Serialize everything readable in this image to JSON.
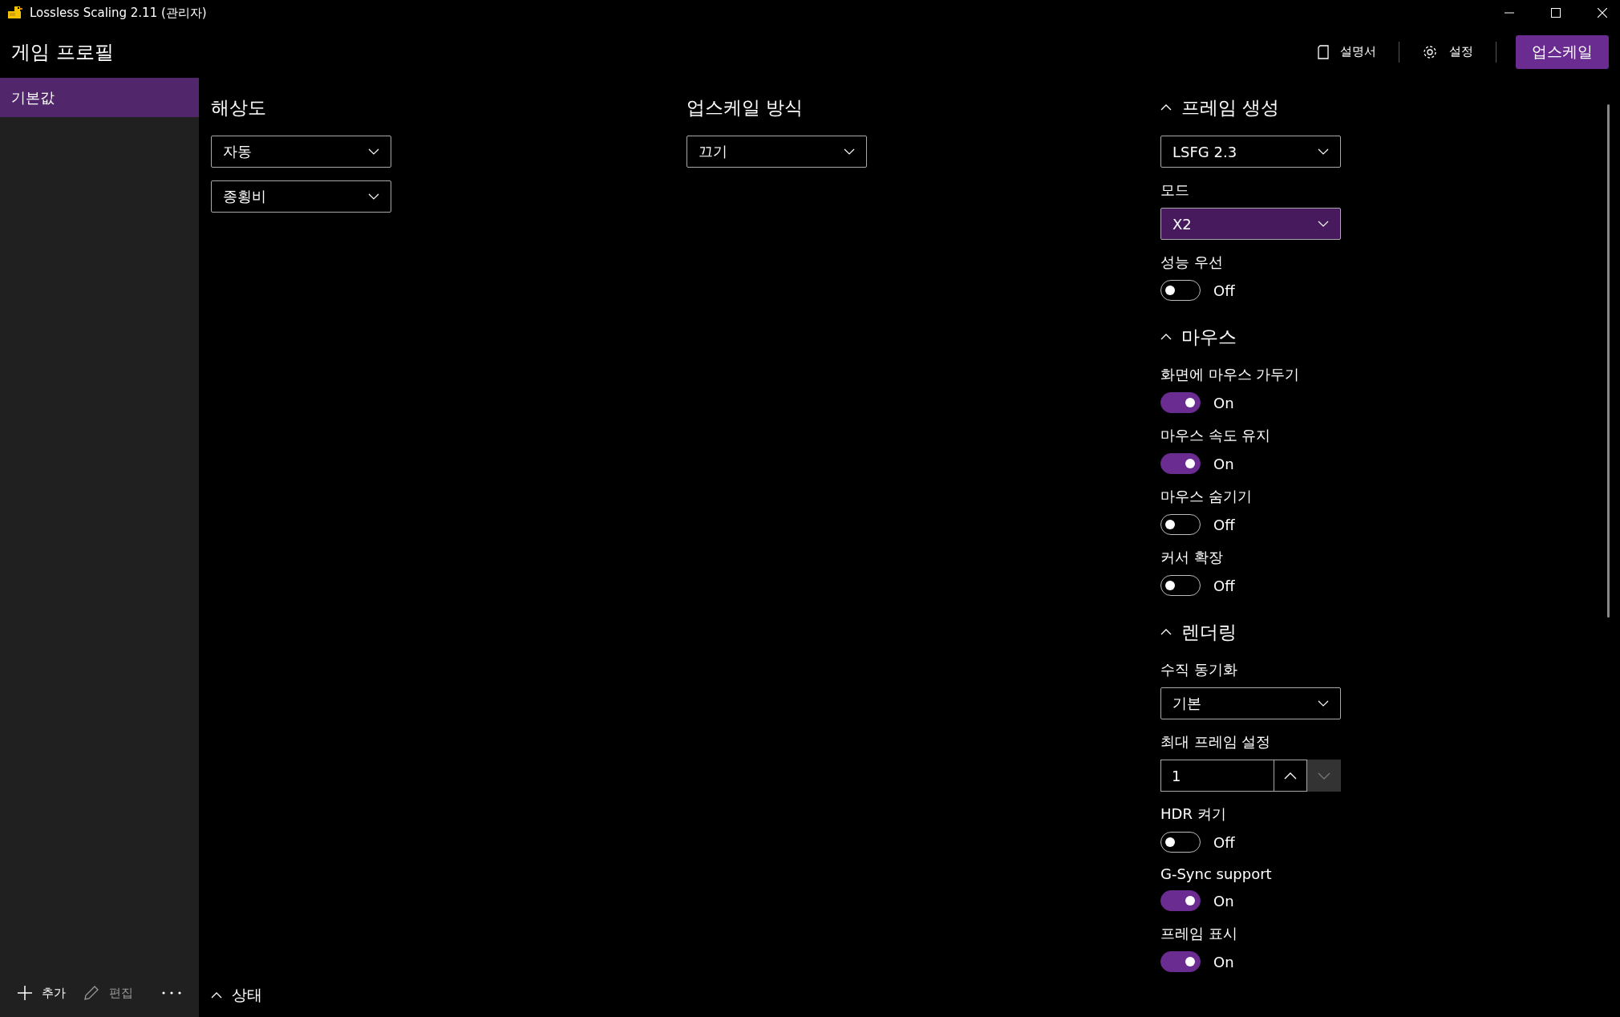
{
  "window": {
    "title": "Lossless Scaling 2.11 (관리자)"
  },
  "header": {
    "title": "게임 프로필",
    "actions": [
      {
        "kind": "doc-link",
        "label": "설명서"
      },
      {
        "kind": "gear-link",
        "label": "설정"
      },
      {
        "kind": "primary",
        "label": "업스케일"
      }
    ]
  },
  "sidebar": {
    "items": [
      {
        "label": "기본값",
        "selected": true
      }
    ],
    "actions": [
      {
        "kind": "add",
        "label": "추가",
        "disabled": false
      },
      {
        "kind": "edit",
        "label": "편집",
        "disabled": true
      },
      {
        "kind": "more",
        "disabled": false
      }
    ]
  },
  "columns": [
    {
      "sections": [
        {
          "title": "해상도",
          "items": [
            {
              "kind": "dropdown",
              "value": "자동",
              "highlighted": false
            },
            {
              "kind": "dropdown",
              "value": "종횡비",
              "highlighted": false
            }
          ]
        }
      ]
    },
    {
      "sections": [
        {
          "title": "업스케일 방식",
          "items": [
            {
              "kind": "dropdown",
              "value": "끄기",
              "highlighted": false
            }
          ]
        }
      ]
    },
    {
      "sections": [
        {
          "title": "프레임 생성",
          "expanded": true,
          "items": [
            {
              "kind": "dropdown",
              "value": "LSFG 2.3",
              "highlighted": false
            },
            {
              "kind": "dropdown",
              "label": "모드",
              "value": "X2",
              "highlighted": true
            },
            {
              "kind": "toggle",
              "label": "성능 우선",
              "on": false,
              "state_text": "Off"
            }
          ]
        },
        {
          "title": "마우스",
          "expanded": true,
          "items": [
            {
              "kind": "toggle",
              "label": "화면에 마우스 가두기",
              "on": true,
              "state_text": "On"
            },
            {
              "kind": "toggle",
              "label": "마우스 속도 유지",
              "on": true,
              "state_text": "On"
            },
            {
              "kind": "toggle",
              "label": "마우스 숨기기",
              "on": false,
              "state_text": "Off"
            },
            {
              "kind": "toggle",
              "label": "커서 확장",
              "on": false,
              "state_text": "Off"
            }
          ]
        },
        {
          "title": "렌더링",
          "expanded": true,
          "items": [
            {
              "kind": "dropdown",
              "label": "수직 동기화",
              "value": "기본",
              "highlighted": false
            },
            {
              "kind": "number",
              "label": "최대 프레임 설정",
              "value": "1",
              "down_disabled": true
            },
            {
              "kind": "toggle",
              "label": "HDR 켜기",
              "on": false,
              "state_text": "Off"
            },
            {
              "kind": "toggle",
              "label": "G-Sync support",
              "on": true,
              "state_text": "On"
            },
            {
              "kind": "toggle",
              "label": "프레임 표시",
              "on": true,
              "state_text": "On"
            }
          ]
        }
      ]
    }
  ],
  "status_panel": {
    "title": "상태"
  }
}
